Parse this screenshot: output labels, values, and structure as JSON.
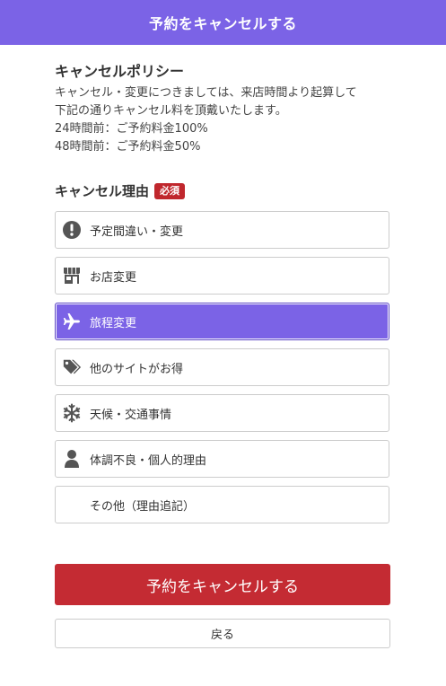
{
  "header": {
    "title": "予約をキャンセルする"
  },
  "policy": {
    "title": "キャンセルポリシー",
    "lines": [
      "キャンセル・変更につきましては、来店時間より起算して",
      "下記の通りキャンセル料を頂戴いたします。",
      "24時間前：ご予約料金100%",
      "48時間前：ご予約料金50%"
    ]
  },
  "reason": {
    "title": "キャンセル理由",
    "required_badge": "必須",
    "options": [
      {
        "label": "予定間違い・変更",
        "icon": "exclamation-circle-icon",
        "selected": false
      },
      {
        "label": "お店変更",
        "icon": "store-icon",
        "selected": false
      },
      {
        "label": "旅程変更",
        "icon": "airplane-icon",
        "selected": true
      },
      {
        "label": "他のサイトがお得",
        "icon": "tags-icon",
        "selected": false
      },
      {
        "label": "天候・交通事情",
        "icon": "snowflake-icon",
        "selected": false
      },
      {
        "label": "体調不良・個人的理由",
        "icon": "person-icon",
        "selected": false
      },
      {
        "label": "その他（理由追記）",
        "icon": "",
        "selected": false
      }
    ]
  },
  "actions": {
    "cancel_label": "予約をキャンセルする",
    "back_label": "戻る"
  },
  "colors": {
    "accent": "#7b63e6",
    "danger": "#c42b33",
    "icon": "#555555"
  }
}
